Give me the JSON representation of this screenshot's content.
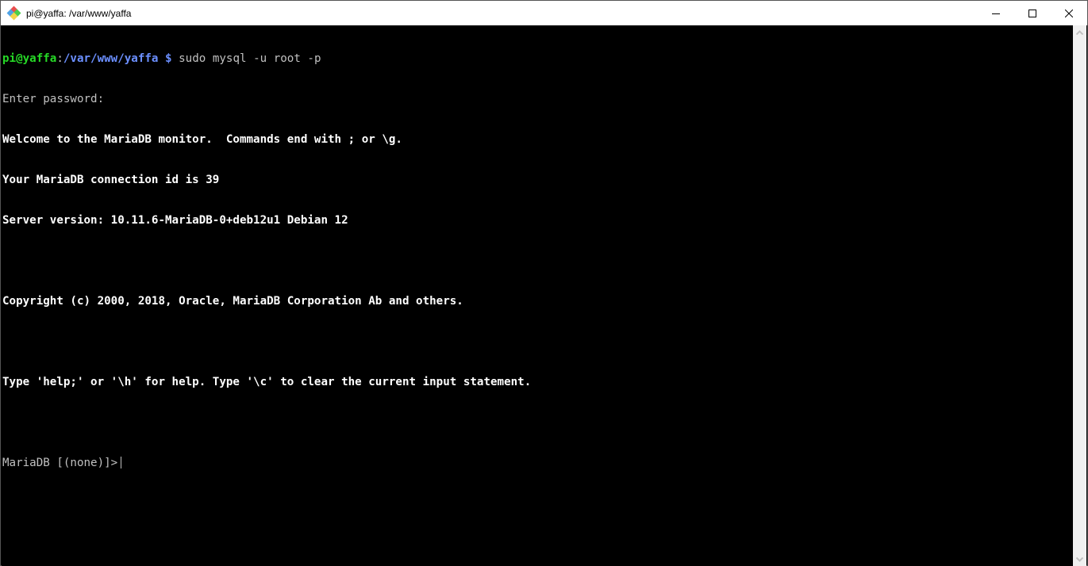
{
  "window": {
    "title": "pi@yaffa: /var/www/yaffa",
    "icon": "git-bash-icon"
  },
  "controls": {
    "minimize": "minimize-icon",
    "maximize": "maximize-icon",
    "close": "close-icon"
  },
  "terminal": {
    "prompt_user": "pi@yaffa",
    "prompt_sep": ":",
    "prompt_path": "/var/www/yaffa",
    "prompt_symbol": " $",
    "command": " sudo mysql -u root -p",
    "lines": [
      "Enter password:",
      "Welcome to the MariaDB monitor.  Commands end with ; or \\g.",
      "Your MariaDB connection id is 39",
      "Server version: 10.11.6-MariaDB-0+deb12u1 Debian 12",
      "",
      "Copyright (c) 2000, 2018, Oracle, MariaDB Corporation Ab and others.",
      "",
      "Type 'help;' or '\\h' for help. Type '\\c' to clear the current input statement.",
      ""
    ],
    "mysql_prompt": "MariaDB [(none)]>"
  }
}
